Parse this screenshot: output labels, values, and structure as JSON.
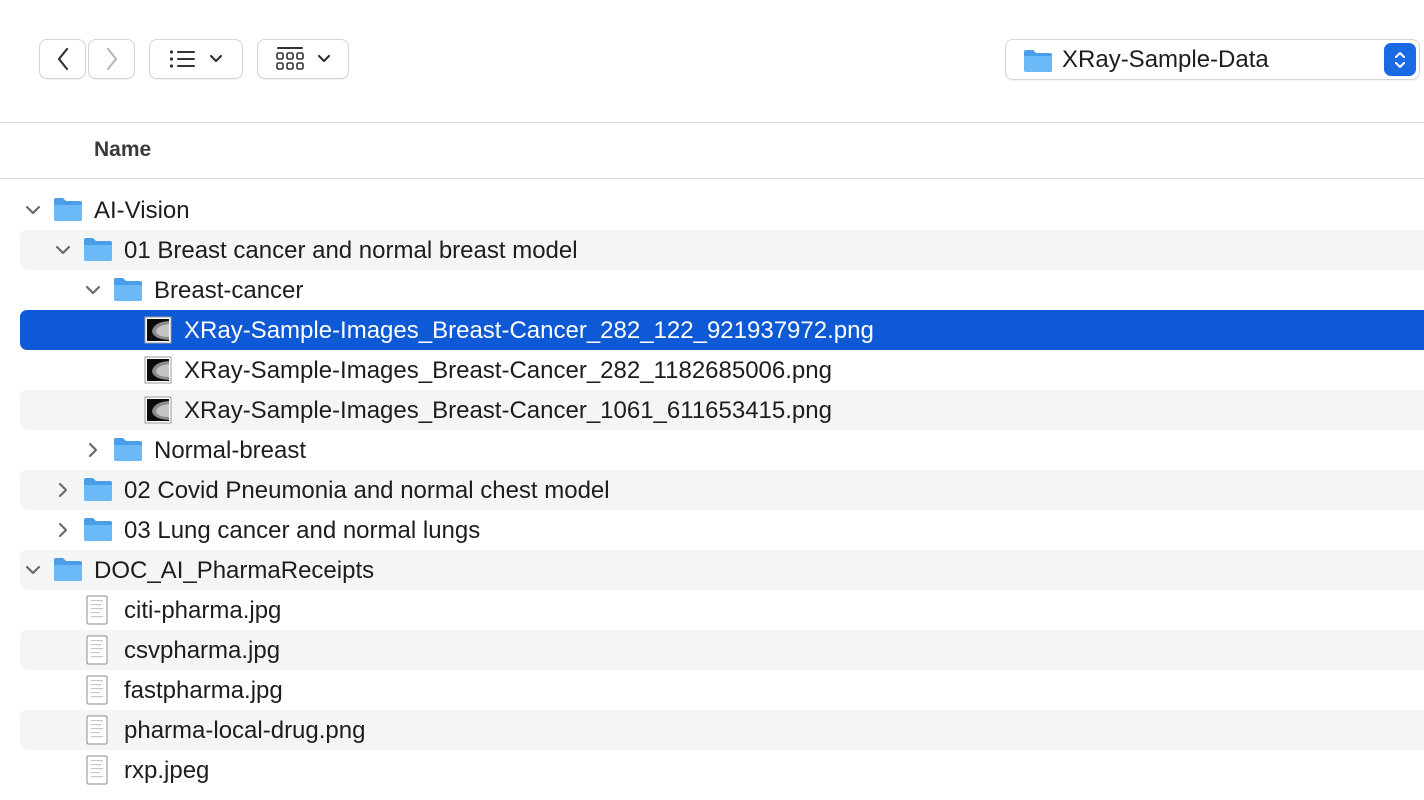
{
  "toolbar": {
    "back_icon": "chevron-left-icon",
    "forward_icon": "chevron-right-icon",
    "view_list_icon": "list-view-icon",
    "group_icon": "grid-group-icon",
    "path_label": "XRay-Sample-Data"
  },
  "columns": {
    "name": "Name"
  },
  "rows": [
    {
      "name": "AI-Vision",
      "type": "folder",
      "expanded": true
    },
    {
      "name": "01 Breast cancer and normal breast model",
      "type": "folder",
      "expanded": true
    },
    {
      "name": "Breast-cancer",
      "type": "folder",
      "expanded": true
    },
    {
      "name": "XRay-Sample-Images_Breast-Cancer_282_122_921937972.png",
      "type": "xray",
      "selected": true
    },
    {
      "name": "XRay-Sample-Images_Breast-Cancer_282_1182685006.png",
      "type": "xray"
    },
    {
      "name": "XRay-Sample-Images_Breast-Cancer_1061_611653415.png",
      "type": "xray"
    },
    {
      "name": "Normal-breast",
      "type": "folder",
      "expanded": false
    },
    {
      "name": "02 Covid Pneumonia and normal chest model",
      "type": "folder",
      "expanded": false
    },
    {
      "name": "03 Lung cancer and normal lungs",
      "type": "folder",
      "expanded": false
    },
    {
      "name": "DOC_AI_PharmaReceipts",
      "type": "folder",
      "expanded": true
    },
    {
      "name": "citi-pharma.jpg",
      "type": "doc"
    },
    {
      "name": "csvpharma.jpg",
      "type": "doc"
    },
    {
      "name": "fastpharma.jpg",
      "type": "doc"
    },
    {
      "name": "pharma-local-drug.png",
      "type": "doc"
    },
    {
      "name": "rxp.jpeg",
      "type": "doc"
    }
  ],
  "colors": {
    "selection": "#0e59d6",
    "folder": "#5aaef5",
    "stepper": "#1a6ae3"
  }
}
